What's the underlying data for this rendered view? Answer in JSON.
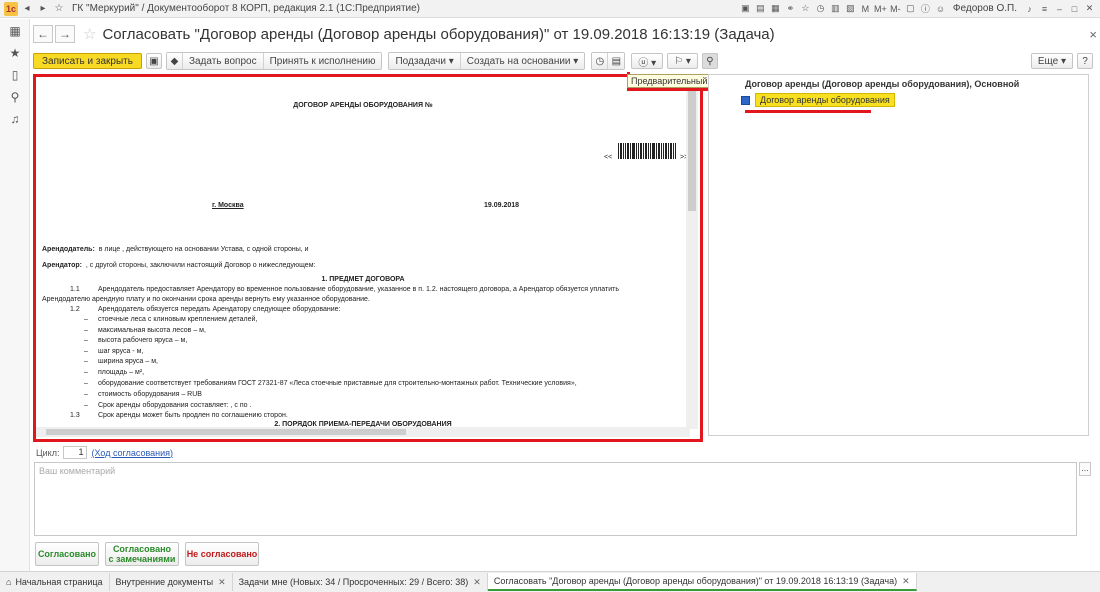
{
  "window": {
    "title": "ГК \"Меркурий\" / Документооборот 8 КОРП, редакция 2.1  (1С:Предприятие)",
    "user": "Федоров О.П.",
    "title_icons": [
      "app-menu-icon",
      "back-icon",
      "forward-icon"
    ]
  },
  "form": {
    "title": "Согласовать \"Договор аренды (Договор аренды оборудования)\" от 19.09.2018 16:13:19 (Задача)",
    "close": "×"
  },
  "toolbar": {
    "save_close": "Записать и закрыть",
    "ask_question": "Задать вопрос",
    "accept": "Принять к исполнению",
    "subtasks": "Подзадачи",
    "create_based": "Создать на основании",
    "more": "Еще",
    "help": "?"
  },
  "tooltip": "Предварительный просмотр файлов",
  "document": {
    "heading": "ДОГОВОР АРЕНДЫ ОБОРУДОВАНИЯ №",
    "nav_left": "<<",
    "nav_right": ">>",
    "city": "г. Москва",
    "date": "19.09.2018",
    "lessor_label": "Арендодатель:",
    "lessor_text": "в лице  , действующего на основании Устава, с одной стороны, и",
    "lessee_label": "Арендатор:",
    "lessee_text": ", с другой стороны, заключили настоящий Договор о нижеследующем:",
    "section1": "1.    ПРЕДМЕТ ДОГОВОРА",
    "p1_1_num": "1.1",
    "p1_1_line1": "Арендодатель предоставляет Арендатору во временное пользование оборудование, указанное в п. 1.2. настоящего договора, а Арендатор обязуется уплатить",
    "p1_1_line2": "Арендодателю арендную плату и по окончании срока аренды вернуть ему указанное оборудование.",
    "p1_2_num": "1.2",
    "p1_2_text": "Арендодатель обязуется передать Арендатору следующее оборудование:",
    "list": [
      "стоечные леса с клиновым креплением деталей,",
      "максимальная высота лесов – м,",
      "высота рабочего яруса – м,",
      "шаг яруса - м,",
      "ширина яруса –  м,",
      "площадь –  м²,",
      "оборудование соответствует требованиям ГОСТ 27321-87 «Леса стоечные приставные для строительно-монтажных работ. Технические условия»,",
      "стоимость оборудования –  RUB",
      "Срок аренды оборудования  составляет:  ,  с по ."
    ],
    "p1_3_num": "1.3",
    "p1_3_text": "Срок аренды может быть продлен по соглашению сторон.",
    "section2": "2.  ПОРЯДОК ПРИЕМА-ПЕРЕДАЧИ ОБОРУДОВАНИЯ"
  },
  "files": {
    "header": "Договор аренды (Договор аренды оборудования), Основной",
    "item": "Договор аренды оборудования"
  },
  "cycle": {
    "label": "Цикл:",
    "value": "1",
    "link": "(Ход согласования)"
  },
  "comment": {
    "placeholder": "Ваш комментарий",
    "more": "..."
  },
  "decisions": {
    "approved": "Согласовано",
    "approved_remarks_1": "Согласовано",
    "approved_remarks_2": "с замечаниями",
    "rejected": "Не согласовано"
  },
  "tabs": [
    {
      "label": "Начальная страница"
    },
    {
      "label": "Внутренние документы"
    },
    {
      "label": "Задачи мне (Новых: 34 / Просроченных: 29 / Всего: 38)"
    },
    {
      "label": "Согласовать \"Договор аренды (Договор аренды оборудования)\" от 19.09.2018 16:13:19 (Задача)"
    }
  ],
  "colors": {
    "accent_yellow": "#f8d924",
    "highlight_red": "#e2161d",
    "approve_green": "#2a8a2a",
    "reject_red": "#c01a1a"
  }
}
